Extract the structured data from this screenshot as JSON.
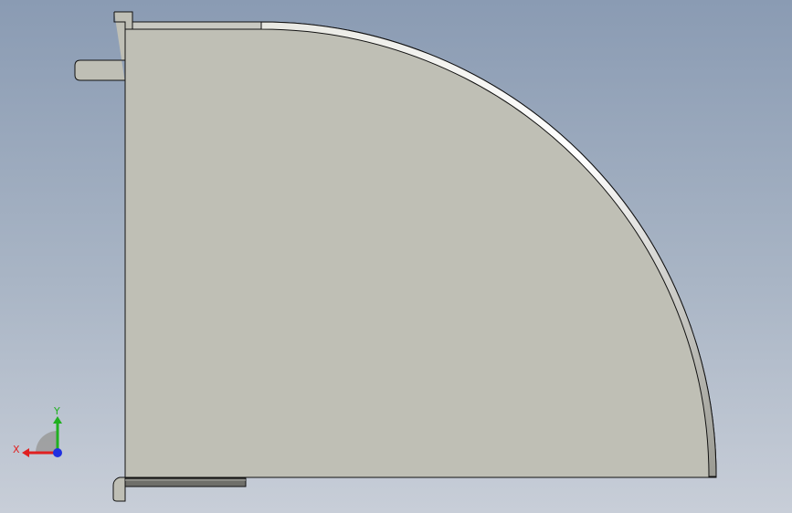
{
  "viewport": {
    "background_top": "#8a9bb3",
    "background_bottom": "#c8ced8"
  },
  "model": {
    "face_color": "#bfbfb5",
    "edge_color": "#111111",
    "flange_highlight": "#f2f2ee"
  },
  "triad": {
    "x_label": "X",
    "y_label": "Y",
    "x_color": "#e02020",
    "y_color": "#20b020",
    "z_color": "#2030e0"
  }
}
